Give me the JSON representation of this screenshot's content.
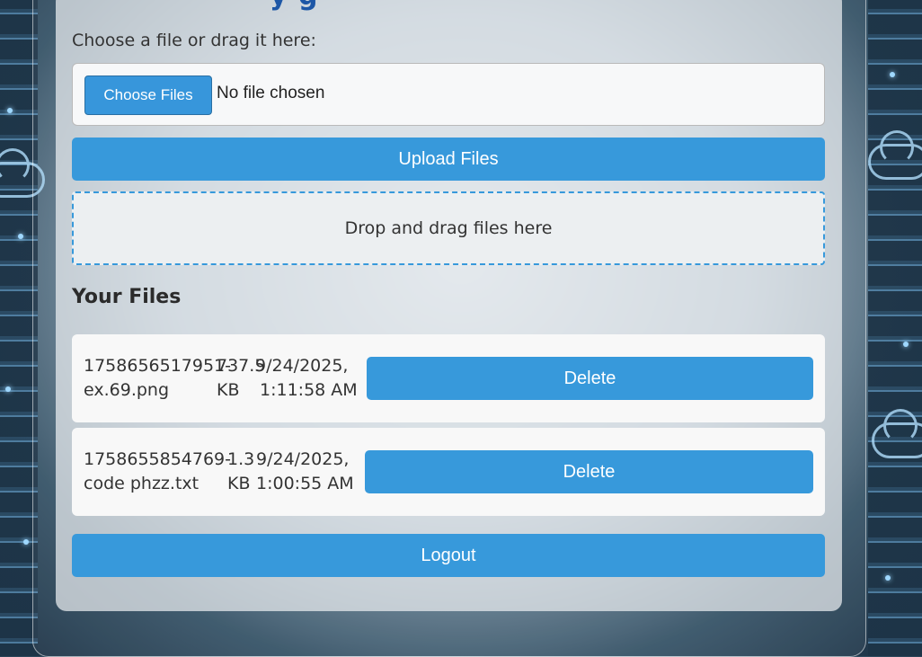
{
  "page": {
    "title_fragment": "y                 g"
  },
  "upload": {
    "choose_label": "Choose a file or drag it here:",
    "choose_files_button": "Choose Files",
    "file_status": "No file chosen",
    "upload_button": "Upload Files",
    "dropzone_text": "Drop and drag files here"
  },
  "files": {
    "heading": "Your Files",
    "items": [
      {
        "name_line1": "1758656517951-",
        "name_line2": "ex.69.png",
        "size_line1": "737.5",
        "size_line2": "KB",
        "date_line1": "9/24/2025,",
        "date_line2": "1:11:58 AM",
        "delete_label": "Delete"
      },
      {
        "name_line1": "1758655854769-",
        "name_line2": "code phzz.txt",
        "size_line1": "1.3",
        "size_line2": "KB",
        "date_line1": "9/24/2025,",
        "date_line2": "1:00:55 AM",
        "delete_label": "Delete"
      }
    ]
  },
  "logout_button": "Logout",
  "colors": {
    "accent": "#3799db",
    "title": "#1d57a6",
    "panel": "#ebeef1"
  }
}
